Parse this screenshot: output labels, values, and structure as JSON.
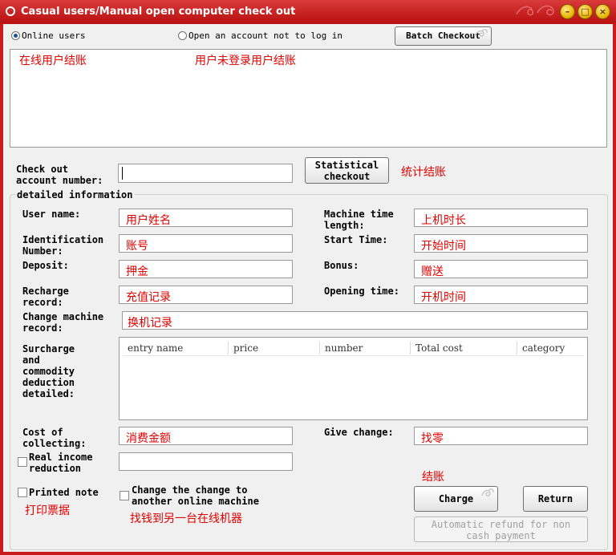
{
  "window": {
    "title": "Casual users/Manual open computer check out",
    "controls": [
      "minimize-icon",
      "maximize-icon",
      "close-icon"
    ]
  },
  "top": {
    "radio_online": "Online users",
    "radio_open": "Open an account not to log in",
    "batch_checkout": "Batch Checkout",
    "note_online": "在线用户结账",
    "note_open": "用户未登录用户结账"
  },
  "checkout": {
    "label_line1": "Check out",
    "label_line2": "account number:",
    "value": "",
    "stat_line1": "Statistical",
    "stat_line2": "checkout",
    "stat_note": "统计结账"
  },
  "details": {
    "group_title": "detailed information",
    "user_name_label": "User name:",
    "user_name_value": "用户姓名",
    "id_label_1": "Identification",
    "id_label_2": "Number:",
    "id_value": "账号",
    "deposit_label": "Deposit:",
    "deposit_value": "押金",
    "recharge_label_1": "Recharge",
    "recharge_label_2": "record:",
    "recharge_value": "充值记录",
    "change_machine_label_1": "Change machine",
    "change_machine_label_2": "record:",
    "change_machine_value": "换机记录",
    "machine_time_label_1": "Machine time",
    "machine_time_label_2": "length:",
    "machine_time_value": "上机时长",
    "start_time_label": "Start Time:",
    "start_time_value": "开始时间",
    "bonus_label": "Bonus:",
    "bonus_value": "赠送",
    "opening_time_label": "Opening time:",
    "opening_time_value": "开机时间",
    "surcharge_label": [
      "Surcharge",
      "and",
      "commodity",
      "deduction",
      "detailed:"
    ],
    "table_columns": [
      "entry name",
      "price",
      "number",
      "Total cost",
      "category"
    ],
    "cost_label_1": "Cost of",
    "cost_label_2": "collecting:",
    "cost_value": "消费金额",
    "give_change_label": "Give change:",
    "give_change_value": "找零",
    "real_income_1": "Real income",
    "real_income_2": "reduction",
    "real_income_value": ""
  },
  "bottom": {
    "printed_note": "Printed note",
    "printed_note_cn": "打印票据",
    "change_to_1": "Change the change to",
    "change_to_2": "another online machine",
    "change_to_cn": "找钱到另一台在线机器",
    "charge_note": "结账",
    "charge_button": "Charge",
    "return_button": "Return",
    "auto_refund_1": "Automatic refund for non",
    "auto_refund_2": "cash payment"
  },
  "colors": {
    "frame": "#c81c1c",
    "annotation": "#e00000",
    "radio_dot": "#1a4fa0"
  }
}
